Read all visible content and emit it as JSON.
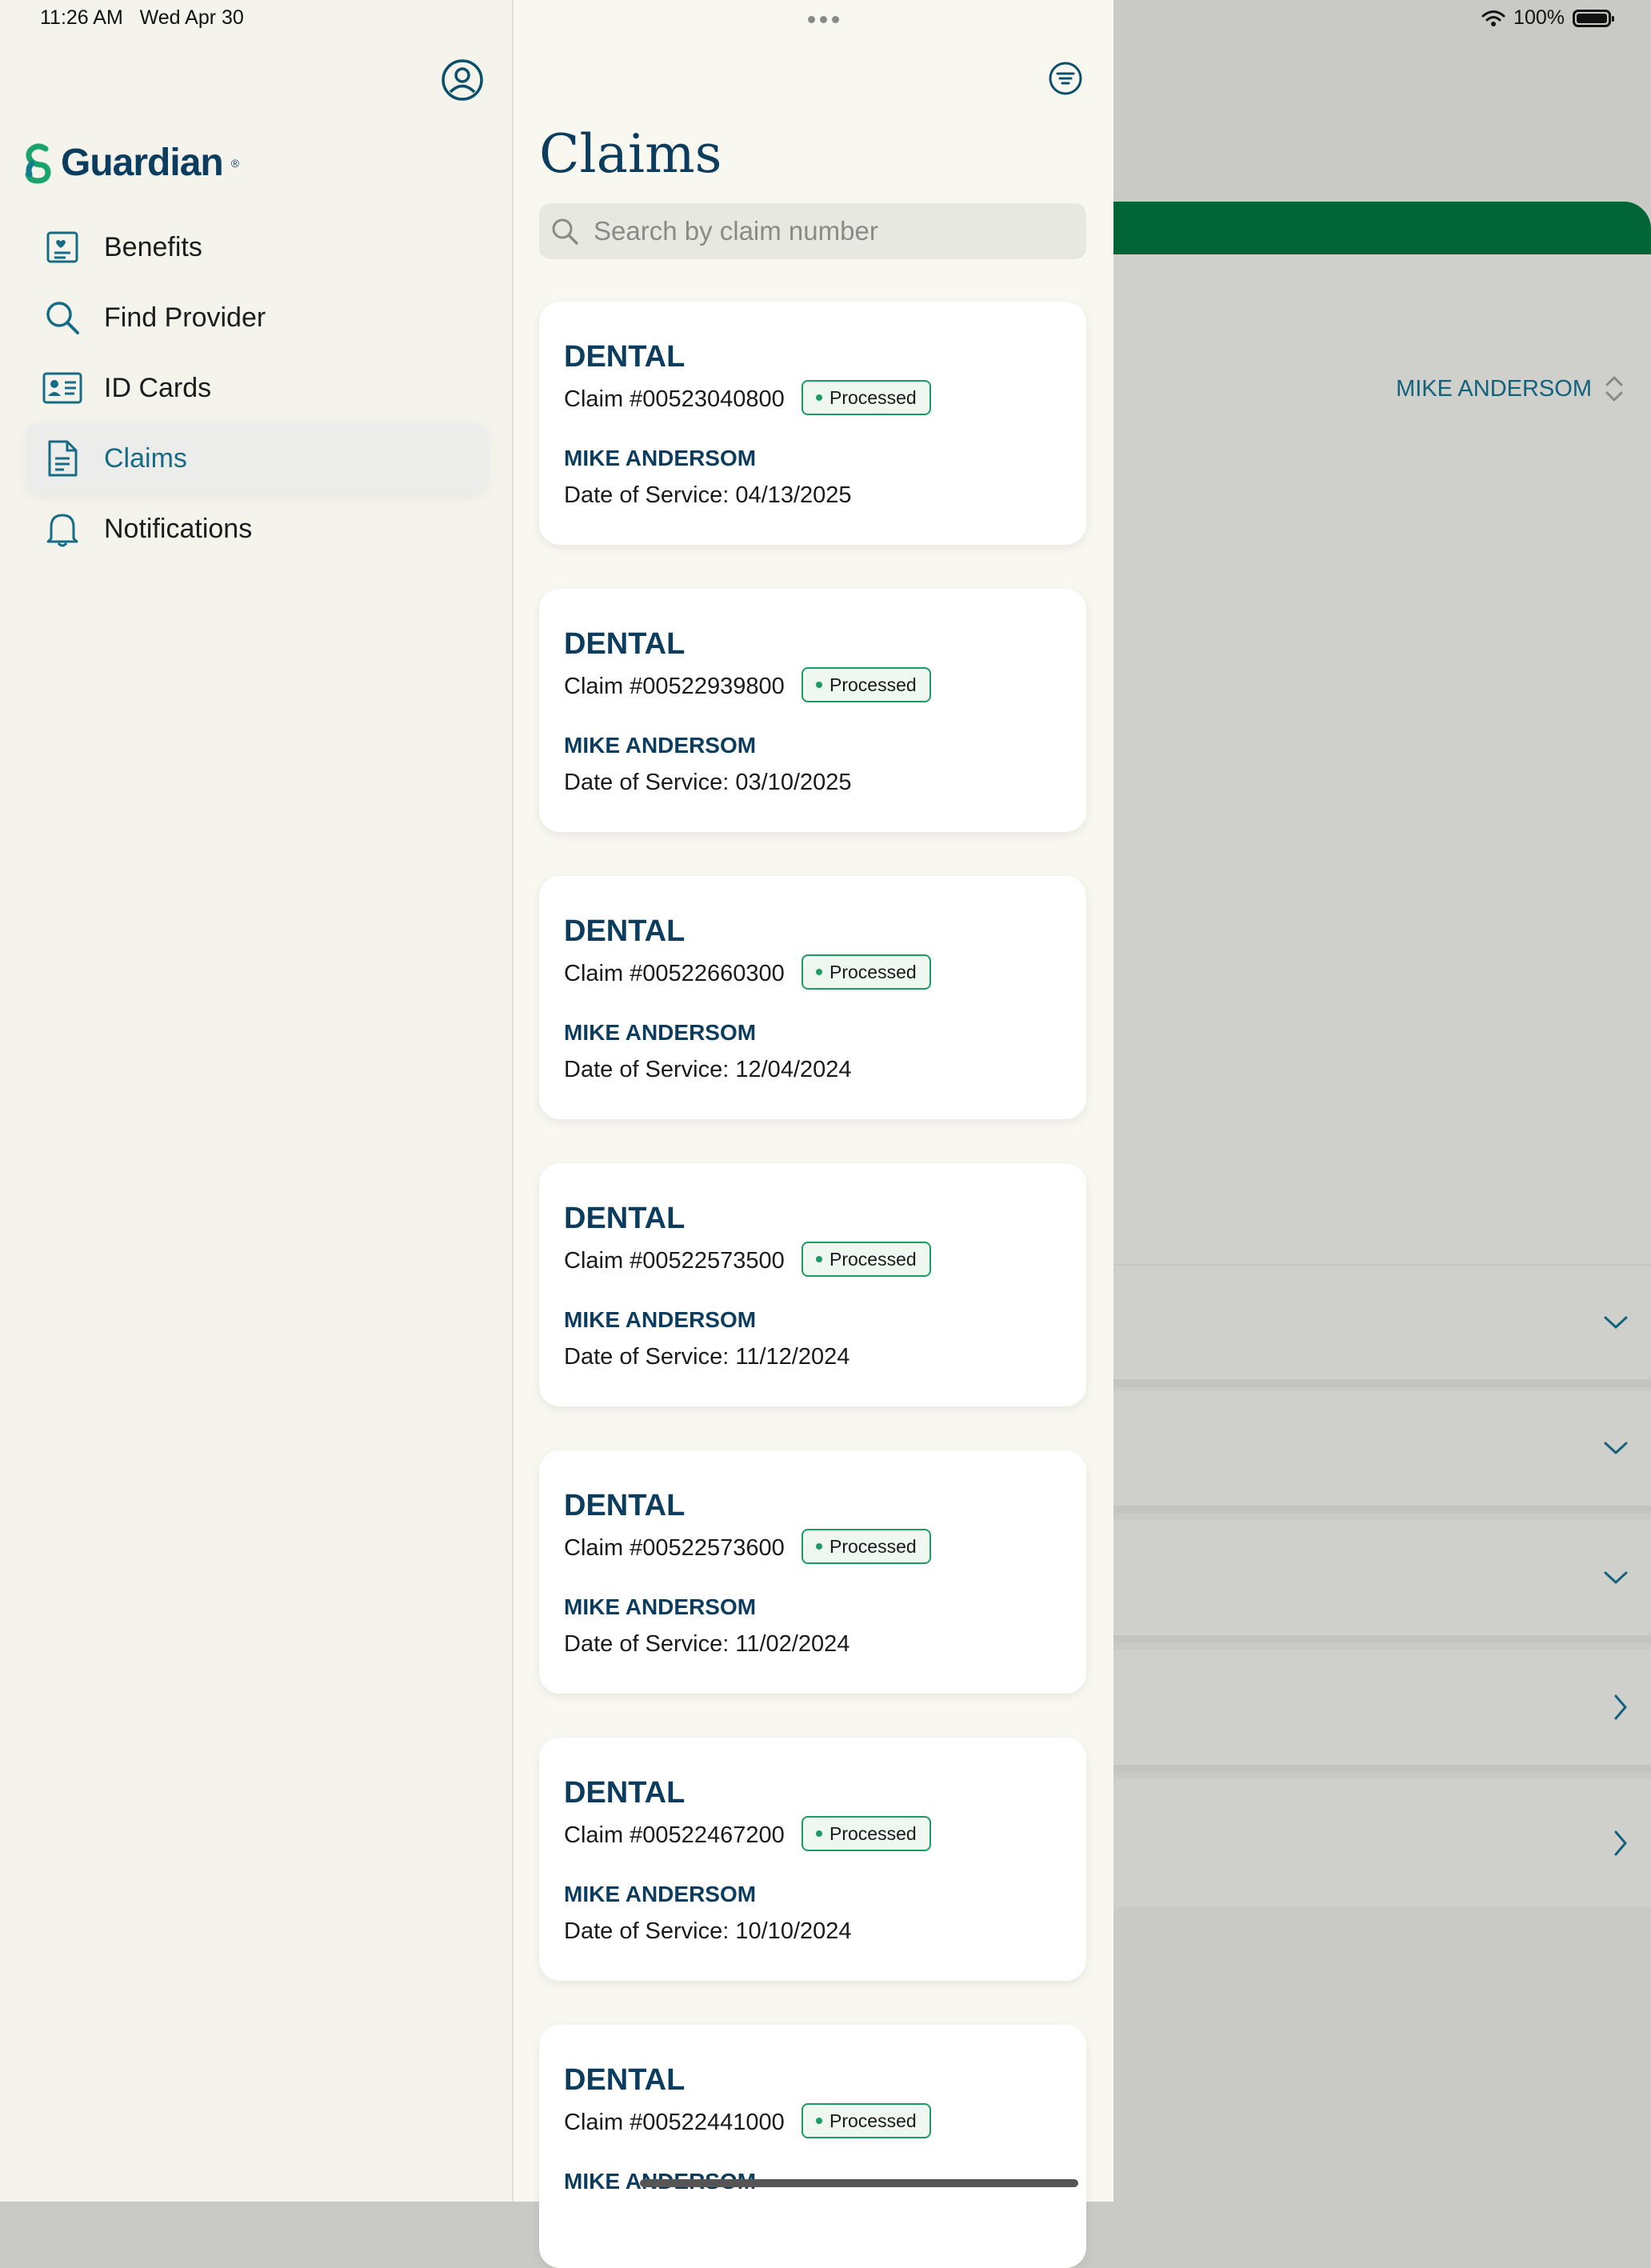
{
  "status_bar": {
    "time": "11:26 AM",
    "date": "Wed Apr 30",
    "battery": "100%",
    "icons": [
      "wifi-icon",
      "battery-icon"
    ]
  },
  "sidebar": {
    "logo_text": "Guardian",
    "logo_mark": "®",
    "items": [
      {
        "label": "Benefits",
        "icon": "benefits-icon",
        "active": false
      },
      {
        "label": "Find Provider",
        "icon": "search-icon",
        "active": false
      },
      {
        "label": "ID Cards",
        "icon": "id-card-icon",
        "active": false
      },
      {
        "label": "Claims",
        "icon": "document-icon",
        "active": true
      },
      {
        "label": "Notifications",
        "icon": "bell-icon",
        "active": false
      }
    ]
  },
  "claims": {
    "title": "Claims",
    "search_placeholder": "Search by claim number",
    "items": [
      {
        "type": "DENTAL",
        "claim": "Claim #00523040800",
        "status": "Processed",
        "member": "MIKE ANDERSOM",
        "date": "Date of Service: 04/13/2025"
      },
      {
        "type": "DENTAL",
        "claim": "Claim #00522939800",
        "status": "Processed",
        "member": "MIKE ANDERSOM",
        "date": "Date of Service: 03/10/2025"
      },
      {
        "type": "DENTAL",
        "claim": "Claim #00522660300",
        "status": "Processed",
        "member": "MIKE ANDERSOM",
        "date": "Date of Service: 12/04/2024"
      },
      {
        "type": "DENTAL",
        "claim": "Claim #00522573500",
        "status": "Processed",
        "member": "MIKE ANDERSOM",
        "date": "Date of Service: 11/12/2024"
      },
      {
        "type": "DENTAL",
        "claim": "Claim #00522573600",
        "status": "Processed",
        "member": "MIKE ANDERSOM",
        "date": "Date of Service: 11/02/2024"
      },
      {
        "type": "DENTAL",
        "claim": "Claim #00522467200",
        "status": "Processed",
        "member": "MIKE ANDERSOM",
        "date": "Date of Service: 10/10/2024"
      },
      {
        "type": "DENTAL",
        "claim": "Claim #00522441000",
        "status": "Processed",
        "member": "MIKE ANDERSOM",
        "date": ""
      }
    ]
  },
  "detail": {
    "member_name": "MIKE ANDERSOM"
  },
  "colors": {
    "brand_navy": "#0c3d5e",
    "accent_teal": "#166c86",
    "brand_green": "#006638",
    "status_green": "#1d9b63"
  }
}
